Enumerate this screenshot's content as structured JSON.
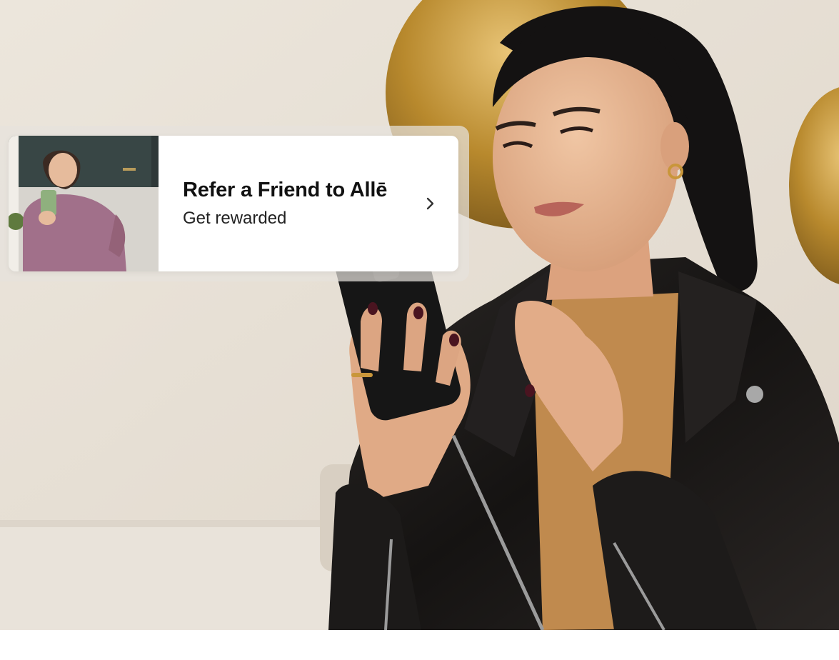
{
  "card": {
    "title": "Refer a Friend to Allē",
    "subtitle": "Get rewarded",
    "chevron_icon": "chevron-right-icon",
    "thumbnail": "woman-taking-selfie-photo"
  },
  "photo": {
    "subject": "woman-using-phone-photo"
  },
  "colors": {
    "wall": "#e8e1d7",
    "gold": "#b98a2e",
    "jacket": "#1b1918",
    "sweater": "#c08a4e",
    "skin": "#e4b08c",
    "hair": "#141212",
    "sofa": "#e9e3da",
    "thumb_top": "#d7d9dc",
    "thumb_sweater": "#a1708a"
  }
}
